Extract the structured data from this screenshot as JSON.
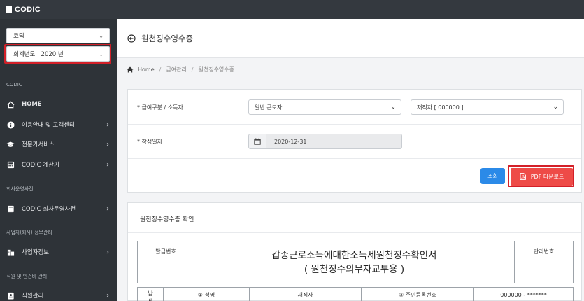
{
  "topbar": {
    "brand": "CODIC"
  },
  "sidebar": {
    "company_select": "코딕",
    "year_select": "회계년도 : 2020 년",
    "sections": {
      "codic": "CODIC",
      "company_dict": "회사운영사전",
      "business_info": "사업자(회사) 정보관리",
      "staff_mgmt": "직원 및 인건비 관리"
    },
    "items": [
      {
        "label": "HOME",
        "icon": "home-icon",
        "has_arrow": false
      },
      {
        "label": "이용안내 및 고객센터",
        "icon": "info-icon",
        "has_arrow": true
      },
      {
        "label": "전문가서비스",
        "icon": "graduation-cap-icon",
        "has_arrow": true
      },
      {
        "label": "CODIC 계산기",
        "icon": "calculator-icon",
        "has_arrow": true
      },
      {
        "label": "CODIC 회사운영사전",
        "icon": "book-icon",
        "has_arrow": true
      },
      {
        "label": "사업자정보",
        "icon": "building-icon",
        "has_arrow": true
      },
      {
        "label": "직원관리",
        "icon": "id-card-icon",
        "has_arrow": true
      }
    ]
  },
  "header": {
    "title": "원천징수영수증"
  },
  "breadcrumb": {
    "home": "Home",
    "level1": "급여관리",
    "level2": "원천징수영수증"
  },
  "form": {
    "type_label": "* 급여구분 / 소득자",
    "type_value": "일반 근로자",
    "person_value": "재직자 [ 000000 ]",
    "date_label": "* 작성일자",
    "date_value": "2020-12-31",
    "search_button": "조회",
    "pdf_button": "PDF 다운로드"
  },
  "receipt": {
    "section_title": "원천징수영수증 확인",
    "issue_no_label": "발급번호",
    "doc_title_line1": "갑종근로소득에대한소득세원천징수확인서",
    "doc_title_line2": "( 원천징수의무자교부용 )",
    "mgmt_no_label": "관리번호",
    "side_label_1": "납",
    "side_label_2": "세",
    "name_label": "① 성명",
    "name_value": "재직자",
    "rrn_label": "② 주민등록번호",
    "rrn_value": "000000 - *******"
  },
  "colors": {
    "sidebar_bg": "#2e3338",
    "topbar_bg": "#34393f",
    "primary_button": "#2b8ae8",
    "pdf_button": "#ee4b47",
    "highlight_border": "#d32028"
  }
}
